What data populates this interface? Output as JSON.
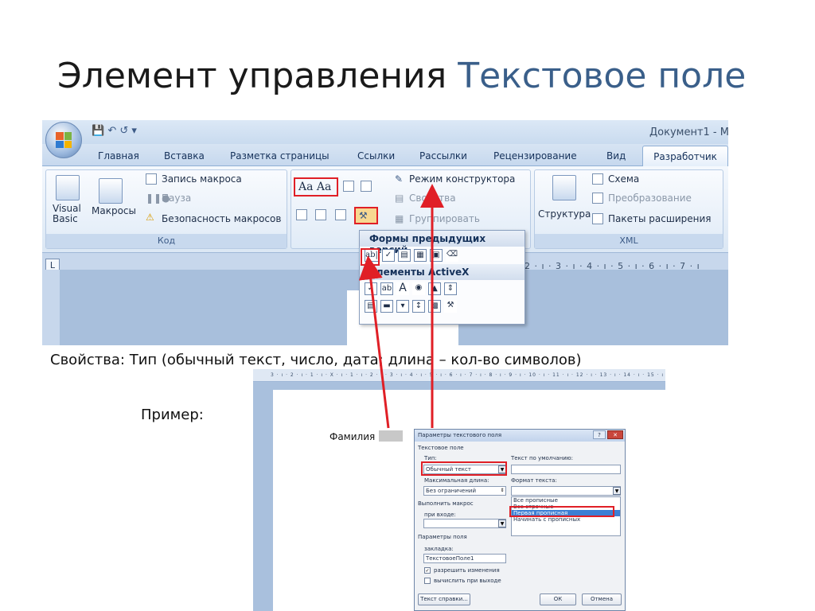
{
  "slide": {
    "title_main": "Элемент управления",
    "title_accent": "Текстовое поле",
    "caption": "Свойства: Тип (обычный текст, число, дата; длина – кол-во символов)",
    "example": "Пример:"
  },
  "ribbon": {
    "doc_title": "Документ1 - M",
    "tabs": [
      "Главная",
      "Вставка",
      "Разметка страницы",
      "Ссылки",
      "Рассылки",
      "Рецензирование",
      "Вид"
    ],
    "active_tab": "Разработчик",
    "code": {
      "visual_basic": "Visual\nBasic",
      "macros": "Макросы",
      "record": "Запись макроса",
      "pause": "Пауза",
      "security": "Безопасность макросов",
      "label": "Код"
    },
    "controls": {
      "aa_label": "Aa Aa",
      "design_mode": "Режим конструктора",
      "properties": "Свойства",
      "group": "Группировать"
    },
    "xml": {
      "structure": "Структура",
      "schema": "Схема",
      "transform": "Преобразование",
      "packages": "Пакеты расширения",
      "label": "XML"
    },
    "ruler_numbers": "2 · ı · 3 · ı · 4 · ı · 5 · ı · 6 · ı · 7 · ı",
    "ruler_corner": "L"
  },
  "palette": {
    "legacy_header": "Формы предыдущих версий",
    "activex_header": "Элементы ActiveX",
    "legacy_first": "ab|"
  },
  "doc_example": {
    "label": "Фамилия"
  },
  "dialog": {
    "title": "Параметры текстового поля",
    "section_field": "Текстовое поле",
    "type_label": "Тип:",
    "type_value": "Обычный текст",
    "default_label": "Текст по умолчанию:",
    "maxlen_label": "Максимальная длина:",
    "maxlen_value": "Без ограничений",
    "format_label": "Формат текста:",
    "format_options": [
      "Все прописные",
      "Все строчные",
      "Первая прописная",
      "Начинать с прописных"
    ],
    "format_selected_index": 2,
    "run_macro": "Выполнить макрос",
    "on_enter": "при входе:",
    "field_params": "Параметры поля",
    "bookmark_label": "закладка:",
    "bookmark_value": "ТекстовоеПоле1",
    "allow_changes": "разрешить изменения",
    "calc_on_exit": "вычислить при выходе",
    "help_button": "Текст справки...",
    "ok_button": "ОК",
    "cancel_button": "Отмена"
  },
  "colors": {
    "accent_title": "#3a5f8a",
    "highlight_red": "#e01f26"
  }
}
